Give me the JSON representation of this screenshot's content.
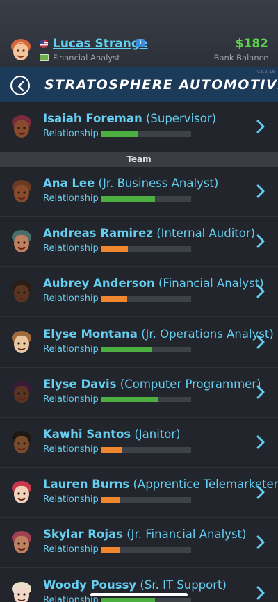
{
  "player": {
    "name": "Lucas Strange",
    "job": "Financial Analyst",
    "balance": "$182",
    "balance_label": "Bank Balance"
  },
  "titlebar": {
    "company": "STRATOSPHERE AUTOMOTIVE",
    "version": "v3.2.16"
  },
  "colors": {
    "good": "#4caf3f",
    "bad": "#f0862d",
    "accent": "#66cff1"
  },
  "supervisor": {
    "name": "Isaiah Foreman",
    "role": "(Supervisor)",
    "rel_label": "Relationship",
    "relationship": 0.41,
    "tone": "good",
    "icon": "avatar-icon"
  },
  "section_label": "Team",
  "team": [
    {
      "name": "Ana Lee",
      "role": "(Jr. Business Analyst)",
      "rel_label": "Relationship",
      "relationship": 0.6,
      "tone": "good"
    },
    {
      "name": "Andreas Ramirez",
      "role": "(Internal Auditor)",
      "rel_label": "Relationship",
      "relationship": 0.3,
      "tone": "bad"
    },
    {
      "name": "Aubrey Anderson",
      "role": "(Financial Analyst)",
      "rel_label": "Relationship",
      "relationship": 0.29,
      "tone": "bad"
    },
    {
      "name": "Elyse Montana",
      "role": "(Jr. Operations Analyst)",
      "rel_label": "Relationship",
      "relationship": 0.57,
      "tone": "good"
    },
    {
      "name": "Elyse Davis",
      "role": "(Computer Programmer)",
      "rel_label": "Relationship",
      "relationship": 0.64,
      "tone": "good"
    },
    {
      "name": "Kawhi Santos",
      "role": "(Janitor)",
      "rel_label": "Relationship",
      "relationship": 0.23,
      "tone": "bad"
    },
    {
      "name": "Lauren Burns",
      "role": "(Apprentice Telemarketer)",
      "rel_label": "Relationship",
      "relationship": 0.21,
      "tone": "bad"
    },
    {
      "name": "Skylar Rojas",
      "role": "(Jr. Financial Analyst)",
      "rel_label": "Relationship",
      "relationship": 0.21,
      "tone": "bad"
    },
    {
      "name": "Woody Poussy",
      "role": "(Sr. IT Support)",
      "rel_label": "Relationship",
      "relationship": 0.6,
      "tone": "good"
    }
  ]
}
